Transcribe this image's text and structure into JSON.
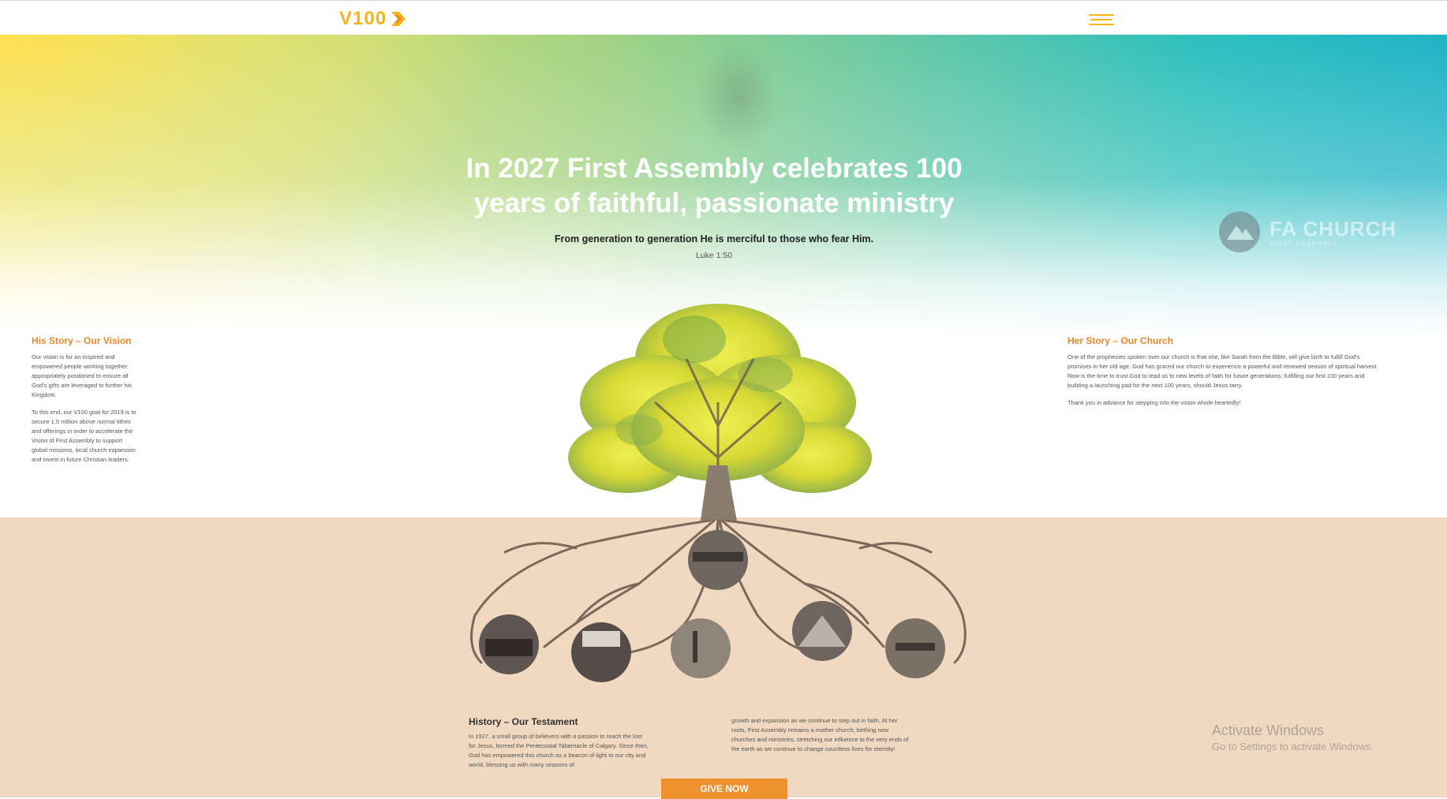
{
  "header": {
    "logo_text": "V100",
    "brand_color": "#f5b417",
    "menu_icon": "hamburger-menu-icon"
  },
  "hero": {
    "headline_line1": "In 2027 First Assembly celebrates 100",
    "headline_line2": "years of faithful, passionate ministry",
    "verse": "From generation to generation He is merciful to those who fear Him.",
    "verse_ref": "Luke 1:50",
    "watermark_name": "FA CHURCH",
    "watermark_tagline": "FIRST ASSEMBLY"
  },
  "his_story": {
    "title": "His Story – Our Vision",
    "p1": "Our vision is for an inspired and empowered people working together, appropriately positioned to ensure all God's gifts are leveraged to further his Kingdom.",
    "p2": "To this end, our V100 goal for 2019 is to secure 1.5 million above normal tithes and offerings in order to accelerate the Vision of First Assembly to support global missions, local church expansion and invest in future Christian leaders."
  },
  "her_story": {
    "title": "Her Story – Our Church",
    "p1": "One of the prophecies spoken over our church is that she, like Sarah from the Bible, will give birth to fulfill God's promises in her old age. God has graced our church to experience a powerful and renewed season of spiritual harvest. Now is the time to trust God to lead us to new levels of faith for future generations; fulfilling our first 100 years and building a launching pad for the next 100 years, should Jesus tarry.",
    "p2": "Thank you in advance for stepping into the vision whole heartedly!"
  },
  "history": {
    "title": "History – Our Testament",
    "p1": "In 1927, a small group of believers with a passion to reach the lost for Jesus, formed the Pentecostal Tabernacle of Calgary. Since then, God has empowered this church as a beacon of light to our city and world, blessing us with many seasons of",
    "p2": "growth and expansion as we continue to step out in faith. At her roots, First Assembly remains a mother church, birthing new churches and ministries, stretching our influence to the very ends of the earth as we continue to change countless lives for eternity!"
  },
  "cta": {
    "give_label": "GIVE NOW",
    "color": "#f0912f"
  },
  "system_overlay": {
    "title": "Activate Windows",
    "subtitle": "Go to Settings to activate Windows."
  },
  "colors": {
    "accent_orange": "#e8862a",
    "soil": "#f1d8c0",
    "sky_left": "#f2e15a",
    "sky_right": "#1fb3c6"
  }
}
